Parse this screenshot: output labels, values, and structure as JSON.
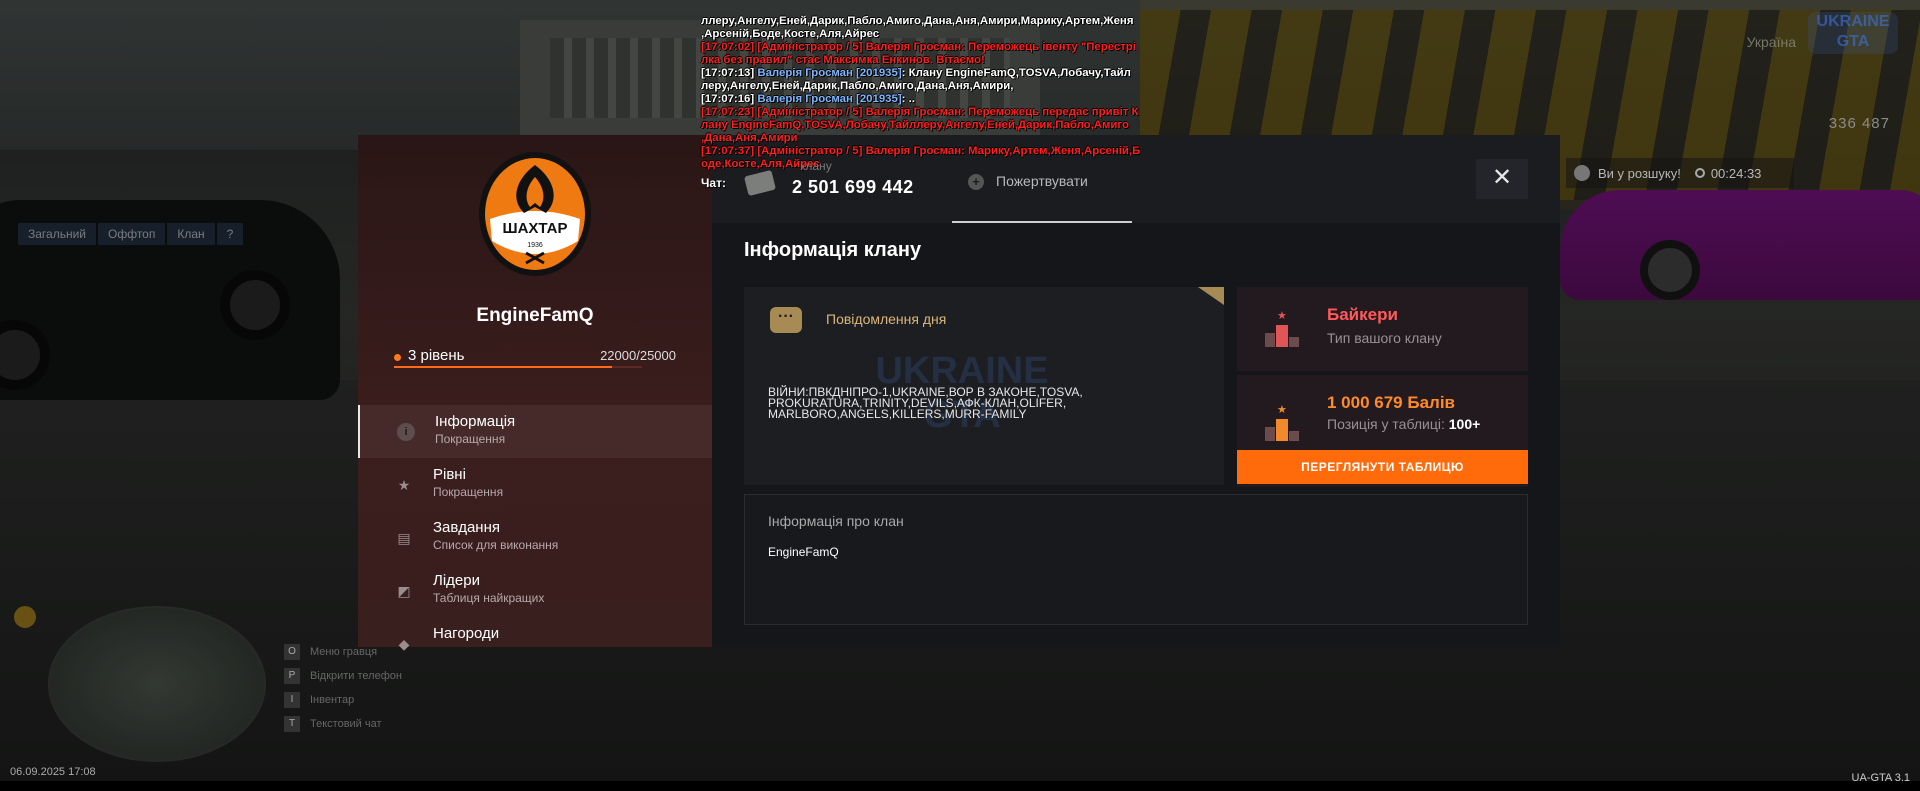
{
  "chat": {
    "lines": [
      {
        "parts": [
          {
            "cls": "w",
            "text": "ллеру,Ангелу,Еней,Дарик,Пабло,Амиго,Дана,Аня,Амири,Марику,Артем,Женя"
          }
        ]
      },
      {
        "parts": [
          {
            "cls": "w",
            "text": ",Арсеній,Боде,Косте,Аля,Айрес"
          }
        ]
      },
      {
        "parts": [
          {
            "cls": "r",
            "text": "[17:07:02] [Адміністратор / 5] Валерія Гросман: Переможець івенту \"Перестрі"
          }
        ]
      },
      {
        "parts": [
          {
            "cls": "r",
            "text": "лка без правил\" стає Максимка Енкинов. Вітаємо!"
          }
        ]
      },
      {
        "parts": [
          {
            "cls": "w",
            "text": "[17:07:13] "
          },
          {
            "cls": "nick",
            "text": "Валерія Гросман [201935]"
          },
          {
            "cls": "w",
            "text": ": Клану EngineFamQ,TOSVA,Лобачу,Тайл"
          }
        ]
      },
      {
        "parts": [
          {
            "cls": "w",
            "text": "леру,Ангелу,Еней,Дарик,Пабло,Амиго,Дана,Аня,Амири,"
          }
        ]
      },
      {
        "parts": [
          {
            "cls": "w",
            "text": "[17:07:16] "
          },
          {
            "cls": "nick",
            "text": "Валерія Гросман [201935]"
          },
          {
            "cls": "w",
            "text": ": .."
          }
        ]
      },
      {
        "parts": [
          {
            "cls": "r",
            "text": "[17:07:23] [Адміністратор / 5] Валерія Гросман: Переможець передає привіт К"
          }
        ]
      },
      {
        "parts": [
          {
            "cls": "r",
            "text": "лану EngineFamQ,TOSVA,Лобачу,Тайллеру,Ангелу,Еней,Дарик,Пабло,Амиго"
          }
        ]
      },
      {
        "parts": [
          {
            "cls": "r",
            "text": ",Дана,Аня,Амири"
          }
        ]
      },
      {
        "parts": [
          {
            "cls": "r",
            "text": "[17:07:37] [Адміністратор / 5] Валерія Гросман: Марику,Артем,Женя,Арсеній,Б"
          }
        ]
      },
      {
        "parts": [
          {
            "cls": "r",
            "text": "оде,Косте,Аля,Айрес"
          }
        ]
      }
    ],
    "input_label": "Чат:",
    "ghost_text": "клану"
  },
  "phone_tabs": [
    "Загальний",
    "Оффтоп",
    "Клан",
    "?"
  ],
  "hud": {
    "logo_text": "UKRAINE GTA",
    "region": "Україна",
    "money": "336 487",
    "wanted_label": "Ви у розшуку!",
    "wanted_timer": "00:24:33"
  },
  "hints": [
    {
      "key": "O",
      "label": "Меню гравця"
    },
    {
      "key": "P",
      "label": "Відкрити телефон"
    },
    {
      "key": "I",
      "label": "Інвентар"
    },
    {
      "key": "T",
      "label": "Текстовий чат"
    }
  ],
  "datetime": "06.09.2025 17:08",
  "version": "UA-GTA 3.1",
  "clan": {
    "name": "EngineFamQ",
    "crest_text": "ШАХТАР",
    "crest_year": "1936",
    "level": "3 рівень",
    "xp": "22000/25000",
    "xp_fraction": 0.88,
    "menu": [
      {
        "title": "Інформація",
        "subtitle": "Покращення",
        "icon": "info-icon",
        "active": true
      },
      {
        "title": "Рівні",
        "subtitle": "Покращення",
        "icon": "star-icon",
        "active": false
      },
      {
        "title": "Завдання",
        "subtitle": "Список для виконання",
        "icon": "message-icon",
        "active": false
      },
      {
        "title": "Лідери",
        "subtitle": "Таблиця найкращих",
        "icon": "chart-icon",
        "active": false
      },
      {
        "title": "Нагороди",
        "subtitle": "",
        "icon": "reward-icon",
        "active": false
      }
    ],
    "balance": "2 501 699 442",
    "donate_label": "Пожертвувати",
    "section_title": "Інформація клану",
    "motd_title": "Повідомлення дня",
    "motd_text": "ВІЙНИ:ПВКДНІПРО-1,UKRAINE,Вор в Законе,TOSVA, PROKURATURA,TRINITY,DEVILS,АФК-Клан,OLIFER, MARLBORO,ANGELS,KILLERS,Murr-Family",
    "type_title": "Байкери",
    "type_sub": "Тип вашого клану",
    "points_title": "1 000 679 Балів",
    "points_sub": "Позиція у таблиці:",
    "points_pos": "100+",
    "table_button": "ПЕРЕГЛЯНУТИ ТАБЛИЦЮ",
    "about_title": "Інформація про клан",
    "about_value": "EngineFamQ"
  },
  "colors": {
    "accent": "#ff6b0a",
    "type_accent": "#ff5a5a",
    "chat_red": "#ff2020",
    "chat_nick": "#7fb6ff"
  }
}
